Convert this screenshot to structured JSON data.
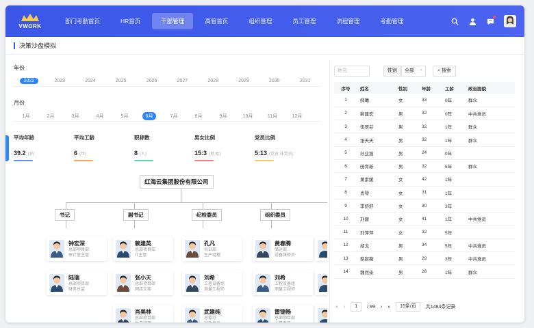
{
  "logo": {
    "text": "VWORK"
  },
  "nav": {
    "items": [
      {
        "label": "部门考勤首页",
        "active": false
      },
      {
        "label": "HR首页",
        "active": false
      },
      {
        "label": "干部管理",
        "active": true
      },
      {
        "label": "高管首页",
        "active": false
      },
      {
        "label": "组织管理",
        "active": false
      },
      {
        "label": "员工管理",
        "active": false
      },
      {
        "label": "流程管理",
        "active": false
      },
      {
        "label": "考勤管理",
        "active": false
      }
    ]
  },
  "page": {
    "title": "决策沙盘模拟"
  },
  "years": {
    "label": "年份",
    "items": [
      "2022",
      "2023",
      "2024",
      "2025",
      "2026",
      "2027",
      "2028",
      "2029",
      "2030",
      "2031"
    ],
    "selected": "2022"
  },
  "months": {
    "label": "月份",
    "items": [
      "1月",
      "2月",
      "3月",
      "4月",
      "5月",
      "6月",
      "7月",
      "8月",
      "9月",
      "10月",
      "11月",
      "12月"
    ],
    "selected": "6月"
  },
  "stats": [
    {
      "title": "平均年龄",
      "value": "39.2",
      "unit": "(岁)",
      "color": "#5b8ff9"
    },
    {
      "title": "平均工龄",
      "value": "6",
      "unit": "(年)",
      "color": "#f6a35c"
    },
    {
      "title": "职称数",
      "value": "8",
      "unit": "(人)",
      "color": "#5ad8a6"
    },
    {
      "title": "男女比例",
      "value": "15:3",
      "unit": "(男:女)",
      "color": "#f08080"
    },
    {
      "title": "党员比例",
      "value": "5:13",
      "unit": "(党员:非党员)",
      "color": "#f6c76b"
    }
  ],
  "org": {
    "root": "红海云集团股份有限公司",
    "depts": [
      "书记",
      "副书记",
      "纪检委员",
      "组织委员"
    ],
    "people": [
      [
        {
          "name": "钟宏深",
          "dept": "总部项目部",
          "role": "审计室主管"
        },
        {
          "name": "陆瑞",
          "dept": "总部项目部",
          "role": "财务总监"
        },
        null
      ],
      [
        {
          "name": "赖建英",
          "dept": "总部项目部",
          "role": "IT主管"
        },
        {
          "name": "张小天",
          "dept": "总部项目部",
          "role": "网店文案"
        },
        {
          "name": "肖美林",
          "dept": "总部项目部",
          "role": "生产经理"
        }
      ],
      [
        {
          "name": "孔凡",
          "dept": "培训部",
          "role": "生产经理"
        },
        {
          "name": "刘希",
          "dept": "工程设备组",
          "role": "测量工程师"
        },
        {
          "name": "武建纯",
          "dept": "总裁办",
          "role": "行政专员"
        }
      ],
      [
        {
          "name": "黄春腾",
          "dept": "储运部",
          "role": "设备维修员"
        },
        {
          "name": "刘希",
          "dept": "工程设备组",
          "role": "测量工程师"
        },
        {
          "name": "雷锦畅",
          "dept": "总部项目部",
          "role": "人事专员"
        }
      ]
    ]
  },
  "filters": {
    "name_placeholder": "姓名",
    "gender_label": "性别",
    "gender_value": "全部",
    "search_label": "搜索"
  },
  "table": {
    "headers": [
      "序号",
      "姓名",
      "性别",
      "年龄",
      "工龄",
      "政治面貌"
    ],
    "rows": [
      [
        "1",
        "薛曦",
        "女",
        "33",
        "0年",
        "群众"
      ],
      [
        "2",
        "赖建宏",
        "男",
        "32",
        "0年",
        "中共党员"
      ],
      [
        "3",
        "伍翠芬",
        "男",
        "32",
        "1年",
        "群众"
      ],
      [
        "4",
        "张天天",
        "男",
        "32",
        "1年",
        "群众"
      ],
      [
        "5",
        "孙业旭",
        "男",
        "24",
        "0年",
        ""
      ],
      [
        "6",
        "田育新",
        "男",
        "32",
        "5年",
        "群众"
      ],
      [
        "7",
        "黄素媛",
        "女",
        "42",
        "1年",
        ""
      ],
      [
        "8",
        "肖琴",
        "女",
        "31",
        "1年",
        ""
      ],
      [
        "9",
        "李舒舒",
        "女",
        "30",
        "3年",
        ""
      ],
      [
        "10",
        "刘健",
        "女",
        "41",
        "1年",
        "中共党员"
      ],
      [
        "11",
        "刘萍萍",
        "女",
        "32",
        "5年",
        ""
      ],
      [
        "12",
        "胡戈",
        "男",
        "34",
        "5年",
        "中共党员"
      ],
      [
        "13",
        "蔡宸薇",
        "男",
        "29",
        "3年",
        "中共党员"
      ],
      [
        "14",
        "魏然染",
        "男",
        "28",
        "1年",
        "群众"
      ]
    ]
  },
  "pager": {
    "current": "1",
    "total_pages": "/ 99",
    "page_size": "15条/页",
    "total": "共1484条记录"
  },
  "colors": {
    "accent": "#3a57e8",
    "chip_active": "#2f86f6"
  }
}
